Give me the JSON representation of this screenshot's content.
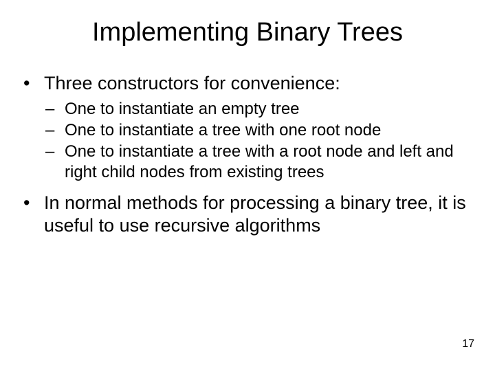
{
  "title": "Implementing Binary Trees",
  "points": {
    "p1": "Three constructors for convenience:",
    "p1_sub": {
      "a": "One to instantiate an empty tree",
      "b": "One to instantiate a tree with one root node",
      "c": "One to instantiate a tree with a root node and left and right child nodes from existing trees"
    },
    "p2": "In normal methods for processing a binary tree, it is useful to use recursive algorithms"
  },
  "page_number": "17"
}
